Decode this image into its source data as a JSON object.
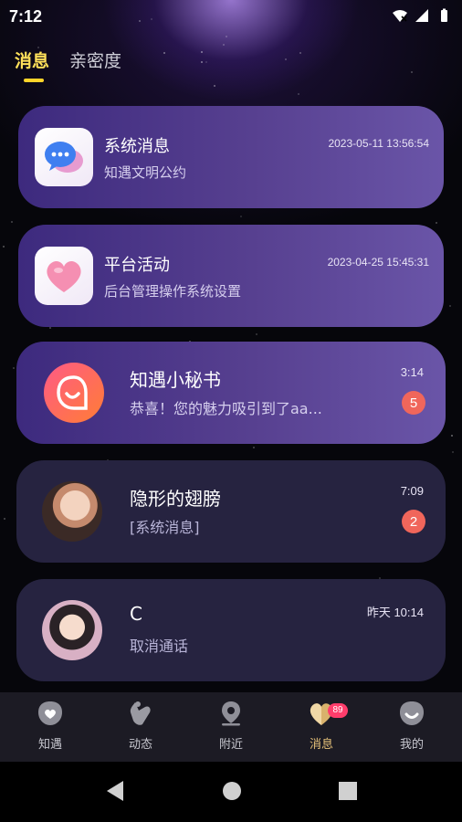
{
  "status_bar": {
    "time": "7:12"
  },
  "tabs": [
    {
      "label": "消息",
      "active": true
    },
    {
      "label": "亲密度",
      "active": false
    }
  ],
  "conversations": [
    {
      "title": "系统消息",
      "preview": "知遇文明公约",
      "time": "2023-05-11 13:56:54",
      "icon": "chat-bubbles-icon"
    },
    {
      "title": "平台活动",
      "preview": "后台管理操作系统设置",
      "time": "2023-04-25 15:45:31",
      "icon": "heart-icon"
    },
    {
      "title": "知遇小秘书",
      "preview": "恭喜！您的魅力吸引到了aa...",
      "time": "3:14",
      "badge": "5",
      "icon": "smile-logo-icon"
    },
    {
      "title": "隐形的翅膀",
      "preview": "[系统消息]",
      "time": "7:09",
      "badge": "2",
      "icon": "user-avatar"
    },
    {
      "title": "C",
      "preview": "取消通话",
      "time": "昨天 10:14",
      "icon": "user-avatar"
    }
  ],
  "bottom_nav": [
    {
      "label": "知遇",
      "icon": "heart-badge-icon",
      "active": false
    },
    {
      "label": "动态",
      "icon": "finger-heart-icon",
      "active": false
    },
    {
      "label": "附近",
      "icon": "location-pin-icon",
      "active": false
    },
    {
      "label": "消息",
      "icon": "heart-icon",
      "active": true,
      "badge": "89"
    },
    {
      "label": "我的",
      "icon": "profile-icon",
      "active": false
    }
  ],
  "colors": {
    "accent": "#ffd42a",
    "badge": "#f0665b",
    "card_purple": "#574090",
    "card_dark": "#262340"
  }
}
